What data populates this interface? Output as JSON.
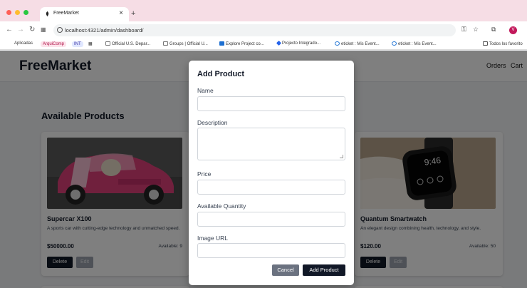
{
  "browser": {
    "tab_title": "FreeMarket",
    "close_glyph": "×",
    "new_tab_glyph": "+",
    "url": "localhost:4321/admin/dashboard/",
    "profile_initial": "V",
    "bookmarks": [
      {
        "label": "Aplicadas"
      },
      {
        "label": "ArquiComp"
      },
      {
        "label": "INT"
      },
      {
        "label": "Official U.S. Depar..."
      },
      {
        "label": "Groups | Official U..."
      },
      {
        "label": "Explore Project co..."
      },
      {
        "label": "Projecto Integrado..."
      },
      {
        "label": "eticket : Mis Event..."
      },
      {
        "label": "eticket : Mis Event..."
      },
      {
        "label": "Todos los favorito"
      }
    ]
  },
  "site": {
    "brand": "FreeMarket",
    "nav": {
      "orders": "Orders",
      "cart": "Cart"
    },
    "section_title": "Available Products"
  },
  "products": [
    {
      "name": "Supercar X100",
      "description": "A sports car with cutting-edge technology and unmatched speed.",
      "price": "$50000.00",
      "available": "Available: 9",
      "delete_label": "Delete",
      "edit_label": "Edit"
    },
    {
      "name": "Quantum Smartwatch",
      "description": "An elegant design combining health, technology, and style.",
      "price": "$120.00",
      "available": "Available: 50",
      "delete_label": "Delete",
      "edit_label": "Edit"
    }
  ],
  "modal": {
    "title": "Add Product",
    "fields": {
      "name": {
        "label": "Name",
        "value": ""
      },
      "description": {
        "label": "Description",
        "value": ""
      },
      "price": {
        "label": "Price",
        "value": ""
      },
      "quantity": {
        "label": "Available Quantity",
        "value": ""
      },
      "image_url": {
        "label": "Image URL",
        "value": ""
      }
    },
    "cancel_label": "Cancel",
    "submit_label": "Add Product"
  },
  "watch_time": "9:46",
  "colors": {
    "tabbar": "#f6dde5",
    "primary_button": "#111827",
    "secondary_button": "#6b7280"
  }
}
